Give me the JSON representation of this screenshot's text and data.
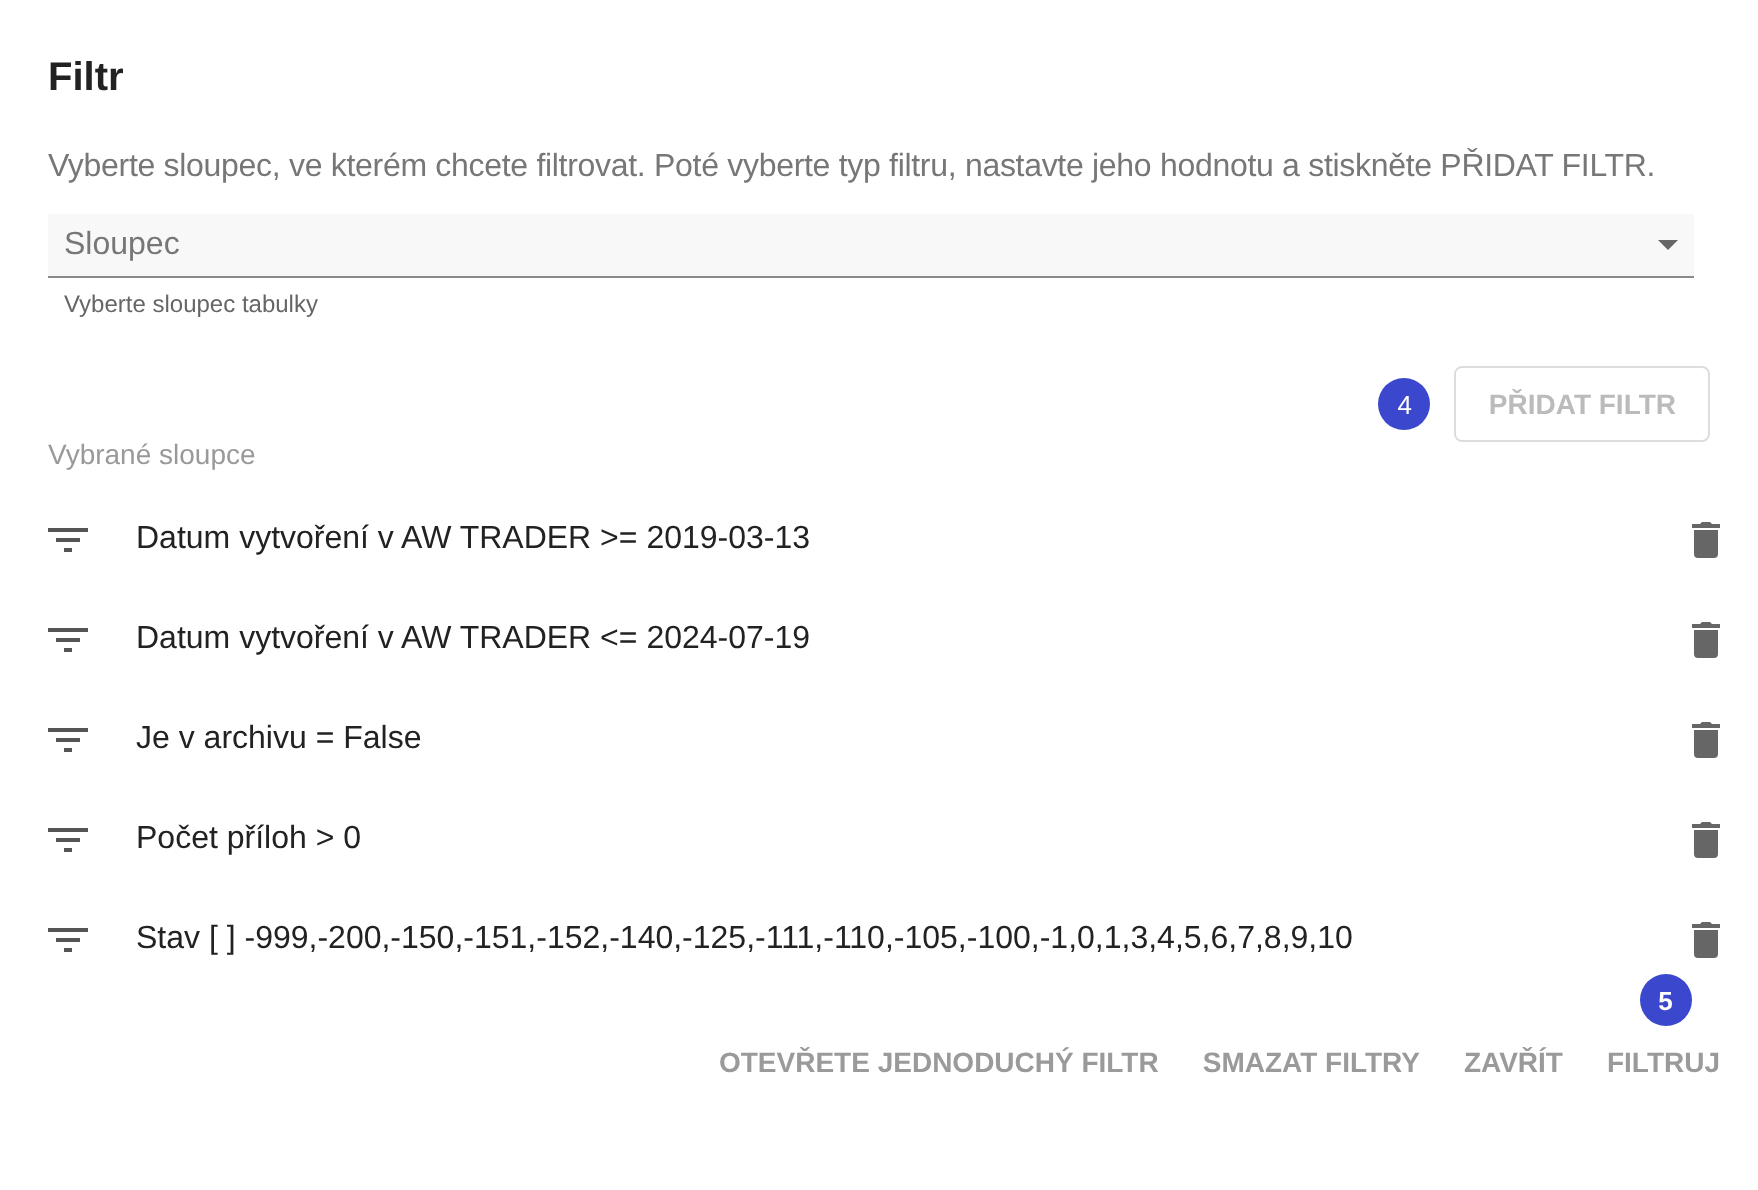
{
  "dialog": {
    "title": "Filtr",
    "description": "Vyberte sloupec, ve kterém chcete filtrovat. Poté vyberte typ filtru, nastavte jeho hodnotu a stiskněte PŘIDAT FILTR."
  },
  "column_select": {
    "placeholder": "Sloupec",
    "helper": "Vyberte sloupec tabulky"
  },
  "add_button": {
    "label": "PŘIDAT FILTR",
    "disabled": true,
    "badge": "4"
  },
  "selected_heading": "Vybrané sloupce",
  "filters": [
    {
      "text": "Datum vytvoření v AW TRADER >= 2019-03-13"
    },
    {
      "text": "Datum vytvoření v AW TRADER <= 2024-07-19"
    },
    {
      "text": "Je v archivu = False"
    },
    {
      "text": "Počet příloh > 0"
    },
    {
      "text": "Stav [ ] -999,-200,-150,-151,-152,-140,-125,-111,-110,-105,-100,-1,0,1,3,4,5,6,7,8,9,10"
    }
  ],
  "footer_buttons": [
    {
      "label": "OTEVŘETE JEDNODUCHÝ FILTR"
    },
    {
      "label": "SMAZAT FILTRY"
    },
    {
      "label": "ZAVŘÍT"
    },
    {
      "label": "FILTRUJ",
      "badge": "5"
    }
  ]
}
